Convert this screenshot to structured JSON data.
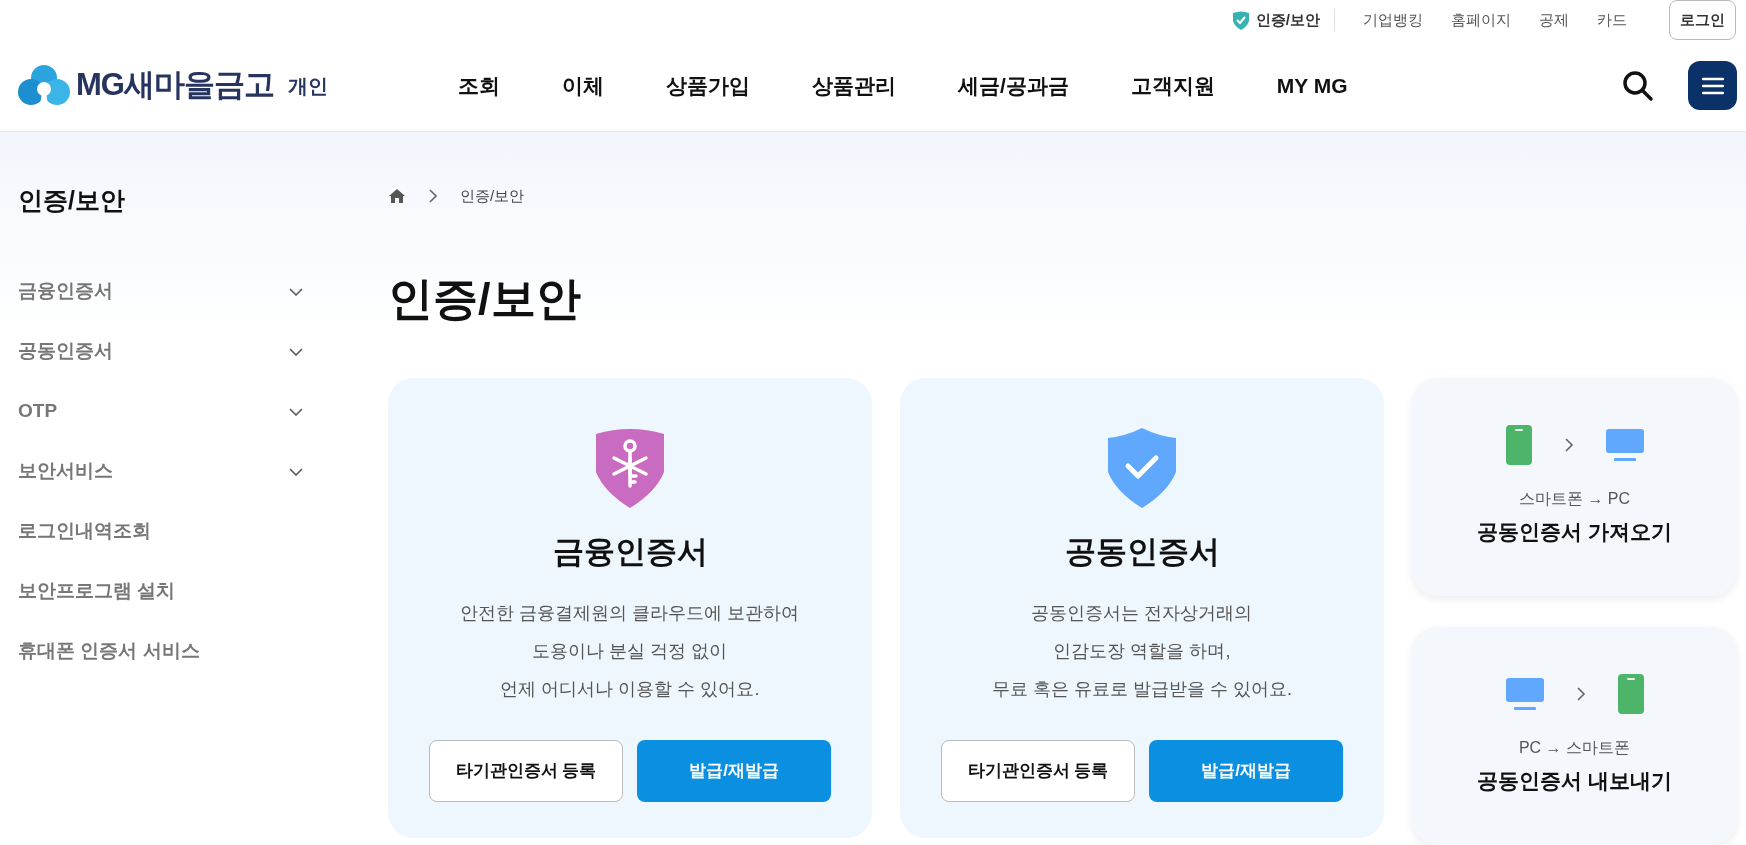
{
  "utility_bar": {
    "items": [
      {
        "label": "인증/보안",
        "selected": true
      },
      {
        "label": "기업뱅킹",
        "selected": false
      },
      {
        "label": "홈페이지",
        "selected": false
      },
      {
        "label": "공제",
        "selected": false
      },
      {
        "label": "카드",
        "selected": false
      }
    ],
    "login": "로그인"
  },
  "header": {
    "brand": "MG새마을금고",
    "brand_sub": "개인",
    "nav": [
      "조회",
      "이체",
      "상품가입",
      "상품관리",
      "세금/공과금",
      "고객지원",
      "MY MG"
    ]
  },
  "sidebar": {
    "title": "인증/보안",
    "items": [
      {
        "label": "금융인증서",
        "kind": "group"
      },
      {
        "label": "공동인증서",
        "kind": "group"
      },
      {
        "label": "OTP",
        "kind": "group"
      },
      {
        "label": "보안서비스",
        "kind": "group"
      },
      {
        "label": "로그인내역조회",
        "kind": "link"
      },
      {
        "label": "보안프로그램 설치",
        "kind": "link"
      },
      {
        "label": "휴대폰 인증서 서비스",
        "kind": "link"
      }
    ]
  },
  "breadcrumb": [
    "인증/보안"
  ],
  "page_title": "인증/보안",
  "cards": [
    {
      "title": "금융인증서",
      "description_lines": [
        "안전한 금융결제원의 클라우드에 보관하여",
        "도용이나 분실 걱정 없이",
        "언제 어디서나 이용할 수 있어요."
      ],
      "buttons": [
        {
          "label": "타기관인증서 등록",
          "kind": "outline"
        },
        {
          "label": "발급/재발급",
          "kind": "primary"
        }
      ]
    },
    {
      "title": "공동인증서",
      "description_lines": [
        "공동인증서는 전자상거래의",
        "인감도장 역할을 하며,",
        "무료 혹은 유료로 발급받을 수 있어요."
      ],
      "buttons": [
        {
          "label": "타기관인증서 등록",
          "kind": "outline"
        },
        {
          "label": "발급/재발급",
          "kind": "primary"
        }
      ]
    }
  ],
  "transfer_cards": [
    {
      "direction": "스마트폰 → PC",
      "title": "공동인증서 가져오기"
    },
    {
      "direction": "PC → 스마트폰",
      "title": "공동인증서 내보내기"
    }
  ]
}
